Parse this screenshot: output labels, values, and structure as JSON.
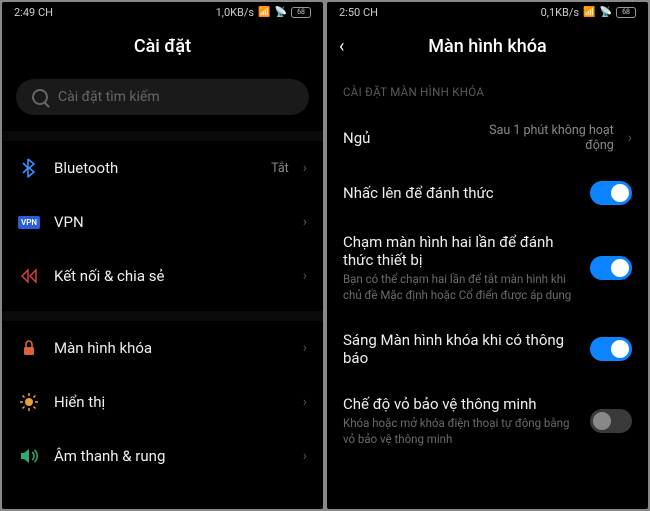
{
  "left": {
    "status": {
      "time": "2:49 CH",
      "speed": "1,0KB/s",
      "battery": "68"
    },
    "title": "Cài đặt",
    "search_placeholder": "Cài đặt tìm kiếm",
    "items": [
      {
        "icon": "bluetooth",
        "label": "Bluetooth",
        "value": "Tắt"
      },
      {
        "icon": "vpn",
        "label": "VPN",
        "value": ""
      },
      {
        "icon": "connect",
        "label": "Kết nối & chia sẻ",
        "value": ""
      }
    ],
    "items2": [
      {
        "icon": "lock",
        "label": "Màn hình khóa"
      },
      {
        "icon": "display",
        "label": "Hiển thị"
      },
      {
        "icon": "sound",
        "label": "Âm thanh & rung"
      }
    ]
  },
  "right": {
    "status": {
      "time": "2:50 CH",
      "speed": "0,1KB/s",
      "battery": "68"
    },
    "title": "Màn hình khóa",
    "section_label": "CÀI ĐẶT MÀN HÌNH KHÓA",
    "sleep": {
      "label": "Ngủ",
      "value": "Sau 1 phút không hoạt động"
    },
    "toggles": [
      {
        "label": "Nhấc lên để đánh thức",
        "sub": "",
        "on": true
      },
      {
        "label": "Chạm màn hình hai lần để đánh thức thiết bị",
        "sub": "Bạn có thể chạm hai lần để tắt màn hình khi chủ đề Mặc định hoặc Cổ điển được áp dụng",
        "on": true
      },
      {
        "label": "Sáng Màn hình khóa khi có thông báo",
        "sub": "",
        "on": true
      },
      {
        "label": "Chế độ vỏ bảo vệ thông minh",
        "sub": "Khóa hoặc mở khóa điện thoại tự động bằng vỏ bảo vệ thông minh",
        "on": false
      }
    ]
  }
}
